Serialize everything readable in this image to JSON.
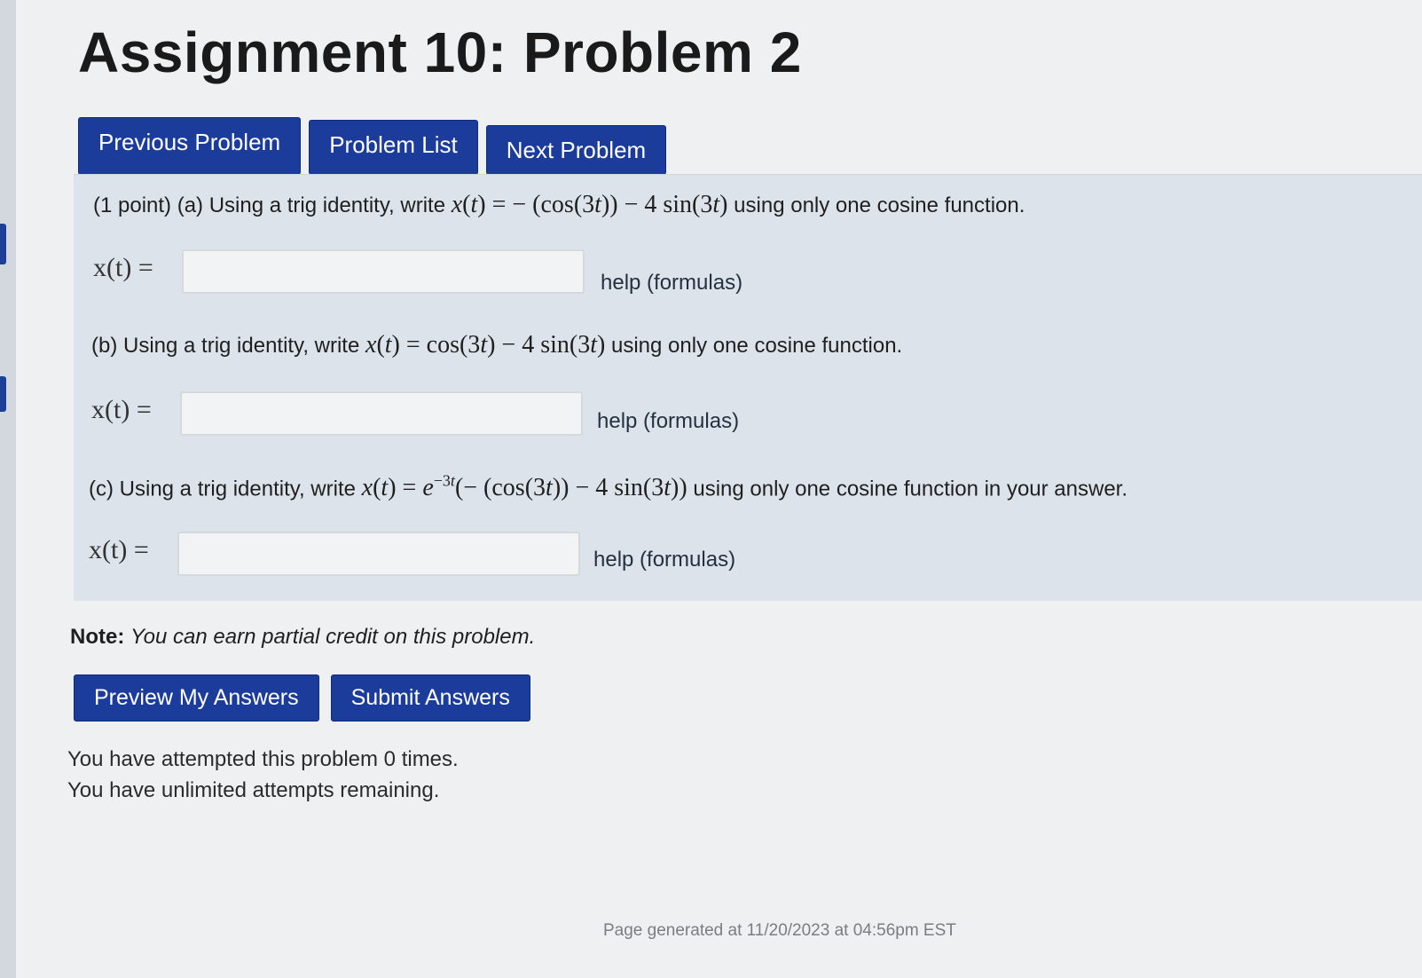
{
  "page": {
    "title": "Assignment 10: Problem 2"
  },
  "nav": {
    "previous": "Previous Problem",
    "list": "Problem List",
    "next": "Next Problem"
  },
  "problem": {
    "points": "(1 point)",
    "part_a": {
      "prefix": "(a) Using a trig identity, write",
      "suffix": "using only one cosine function.",
      "lhs": "x(t) =",
      "answer": "",
      "help": "help (formulas)"
    },
    "part_b": {
      "prefix": "(b) Using a trig identity, write",
      "suffix": "using only one cosine function.",
      "lhs": "x(t) =",
      "answer": "",
      "help": "help (formulas)"
    },
    "part_c": {
      "prefix": "(c) Using a trig identity, write",
      "suffix": "using only one cosine function in your answer.",
      "lhs": "x(t) =",
      "answer": "",
      "help": "help (formulas)"
    }
  },
  "note": {
    "label": "Note:",
    "text": "You can earn partial credit on this problem."
  },
  "actions": {
    "preview": "Preview My Answers",
    "submit": "Submit Answers"
  },
  "status": {
    "attempted": "You have attempted this problem 0 times.",
    "remaining": "You have unlimited attempts remaining."
  },
  "footer": {
    "generated": "Page generated at 11/20/2023 at 04:56pm EST"
  }
}
